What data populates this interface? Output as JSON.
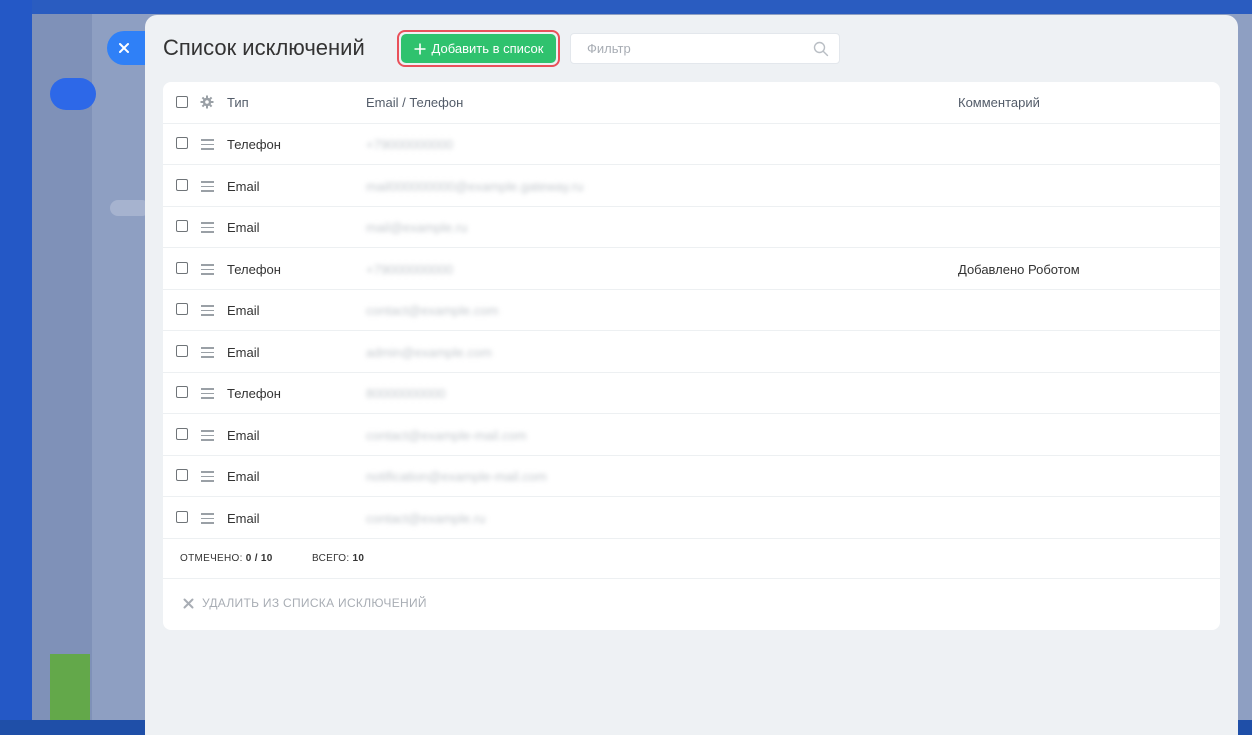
{
  "panel": {
    "title": "Список исключений",
    "add_button_label": "Добавить в список",
    "filter_placeholder": "Фильтр"
  },
  "table": {
    "headers": {
      "type": "Тип",
      "value": "Email / Телефон",
      "comment": "Комментарий"
    },
    "rows": [
      {
        "type": "Телефон",
        "value": "+79000000000",
        "comment": ""
      },
      {
        "type": "Email",
        "value": "mail000000000@example.gateway.ru",
        "comment": ""
      },
      {
        "type": "Email",
        "value": "mail@example.ru",
        "comment": ""
      },
      {
        "type": "Телефон",
        "value": "+79000000000",
        "comment": "Добавлено Роботом"
      },
      {
        "type": "Email",
        "value": "contact@example.com",
        "comment": ""
      },
      {
        "type": "Email",
        "value": "admin@example.com",
        "comment": ""
      },
      {
        "type": "Телефон",
        "value": "80000000000",
        "comment": ""
      },
      {
        "type": "Email",
        "value": "contact@example-mail.com",
        "comment": ""
      },
      {
        "type": "Email",
        "value": "notification@example-mail.com",
        "comment": ""
      },
      {
        "type": "Email",
        "value": "contact@example.ru",
        "comment": ""
      }
    ]
  },
  "footer": {
    "selected_label": "ОТМЕЧЕНО:",
    "selected_value": "0 / 10",
    "total_label": "ВСЕГО:",
    "total_value": "10",
    "delete_action": "УДАЛИТЬ ИЗ СПИСКА ИСКЛЮЧЕНИЙ"
  },
  "colors": {
    "accent_blue": "#2f80f7",
    "add_green": "#2fc26e",
    "highlight_red": "#e9515a"
  },
  "icons": {
    "close": "close-icon",
    "add": "plus-icon",
    "search": "search-icon",
    "settings": "gear-icon",
    "drag": "drag-handle-icon",
    "delete": "x-icon"
  }
}
